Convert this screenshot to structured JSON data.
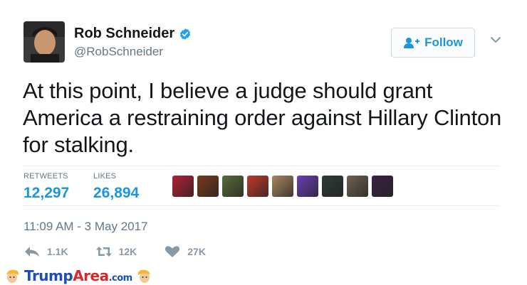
{
  "user": {
    "name": "Rob Schneider",
    "handle": "@RobSchneider"
  },
  "follow_button": {
    "label": "Follow"
  },
  "tweet": {
    "text": "At this point, I believe a judge should grant America a restraining order against Hillary Clinton for stalking."
  },
  "stats": {
    "retweets_label": "RETWEETS",
    "retweets_value": "12,297",
    "likes_label": "LIKES",
    "likes_value": "26,894"
  },
  "likers": [
    {
      "name": "liker-flag-avatar",
      "color": "#b22234"
    },
    {
      "name": "liker-banner-avatar",
      "color": "#7a3a1c"
    },
    {
      "name": "liker-group-avatar",
      "color": "#5a6b3a"
    },
    {
      "name": "liker-redhead-avatar",
      "color": "#c0392b"
    },
    {
      "name": "liker-couple-avatar",
      "color": "#a88560"
    },
    {
      "name": "liker-purple-avatar",
      "color": "#6a3fb5"
    },
    {
      "name": "liker-dark-avatar",
      "color": "#2f3b35"
    },
    {
      "name": "liker-man-avatar",
      "color": "#6e6250"
    },
    {
      "name": "liker-night-avatar",
      "color": "#3a2145"
    }
  ],
  "timestamp": "11:09 AM - 3 May 2017",
  "actions": {
    "reply_count": "1.1K",
    "retweet_count": "12K",
    "like_count": "27K"
  },
  "watermark": {
    "part1": "Trump",
    "part2": "Area",
    "part3": ".com"
  },
  "colors": {
    "accent": "#1b95e0",
    "muted": "#657786",
    "icon_gray": "#8899a6",
    "verified": "#1da1f2"
  }
}
